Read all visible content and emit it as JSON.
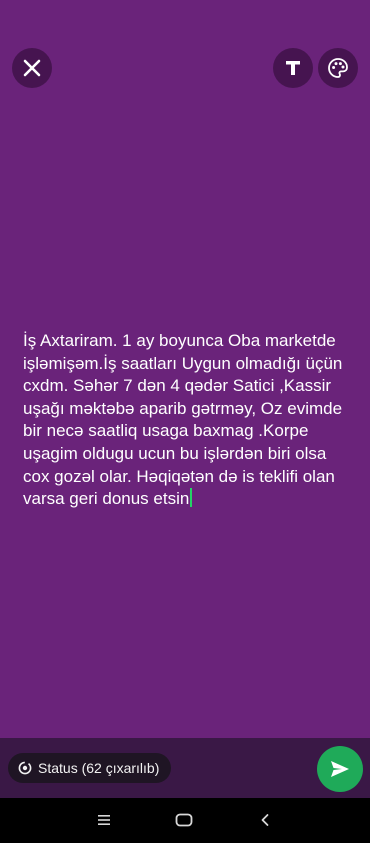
{
  "composer": {
    "text": "İş Axtariram. 1 ay boyunca Oba marketde işləmişəm.İş saatları Uygun olmadığı üçün cxdm. Səhər 7 dən 4 qədər Satici ,Kassir uşağı məktəbə aparib gətrməy, Oz evimde bir necə saatliq usaga baxmag .Korpe uşagim oldugu ucun bu işlərdən biri olsa cox gozəl olar. Həqiqətən də is teklifi olan varsa geri donus etsin"
  },
  "audience": {
    "label": "Status (62 çıxarılıb)"
  },
  "icons": {
    "close": "close-icon",
    "text_style": "text-icon",
    "color_palette": "palette-icon",
    "audience": "status-icon",
    "send": "send-icon",
    "nav_recents": "recents-icon",
    "nav_home": "home-icon",
    "nav_back": "back-icon"
  },
  "colors": {
    "background": "#6a237a",
    "accent": "#1faa59",
    "caret": "#25d366"
  }
}
